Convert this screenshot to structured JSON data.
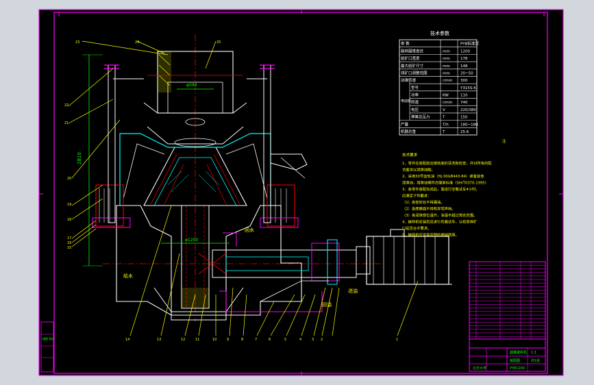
{
  "drawing": {
    "params_title": "技术参数",
    "params_table": {
      "headers": [
        "参 数",
        "",
        "PYB标准型"
      ],
      "rows": [
        [
          "破碎圆锥直径",
          "mm",
          "1200"
        ],
        [
          "给矿口宽度",
          "mm",
          "178"
        ],
        [
          "最大给矿尺寸",
          "mm",
          "148"
        ],
        [
          "排矿口调整范围",
          "mm",
          "20~50"
        ],
        [
          "动锥转速",
          "r/min",
          "300"
        ],
        [
          "型号",
          "",
          "Y315S-6"
        ],
        [
          "功率",
          "KW",
          "110"
        ],
        [
          "转速",
          "r/min",
          "740"
        ],
        [
          "电压",
          "V",
          "220/380"
        ],
        [
          "弹簧总压力",
          "T",
          "150"
        ],
        [
          "产量",
          "T/h",
          "180~180"
        ],
        [
          "机器总重",
          "T",
          "25.6"
        ]
      ],
      "motor_group_label": "电动机"
    },
    "notes_header": "注",
    "notes_subheader": "技术要求",
    "notes": [
      "1、零件在装配前应做彻底的清洗和检查，并对所有的配",
      "   合面涂以润滑油脂。",
      "2、采用30号齿轮油（HJ-30GB443-84）或者其他",
      "   润滑油，润滑油需符合国家标准（SH/T0370-1995）",
      "3、各零件装配完成后，需进行空载试车4小时，",
      "   应满足下列要求：",
      "   （1）各密封处不得漏油。",
      "   （2）各摩擦面不得有异常声响。",
      "   （3）各润滑部位温升，油温不超过规定范围。",
      "4、破碎机安装后应进行负载试车，以检查排矿",
      "   口是否合乎要求。",
      "5、破碎机应安装牢固的基础底座。"
    ],
    "balloons": [
      "1",
      "2",
      "3",
      "4",
      "5",
      "6",
      "7",
      "8",
      "9",
      "10",
      "11",
      "12",
      "13",
      "14",
      "15",
      "16",
      "17",
      "18",
      "19",
      "20",
      "21",
      "22",
      "23",
      "24",
      "25"
    ],
    "annotations": {
      "feed": "给水",
      "return": "回水",
      "oil_in": "进油",
      "oil_out": "回油",
      "dim_d": "φ1200",
      "dim_d2": "φ590",
      "dim_h": "2810"
    },
    "title_block": {
      "name": "圆锥破碎机",
      "assembly": "装配图",
      "scale": "1:1",
      "sheet": "共1张",
      "company": "北华大学",
      "drawing_no": "PYB1200"
    },
    "left_stamp": "描图 校对"
  },
  "colors": {
    "background": "#000000",
    "frame": "#ff00ff",
    "outline": "#ffffff",
    "cyan": "#00ffff",
    "yellow": "#ffff00",
    "red": "#ff0000",
    "green": "#00ff00"
  }
}
